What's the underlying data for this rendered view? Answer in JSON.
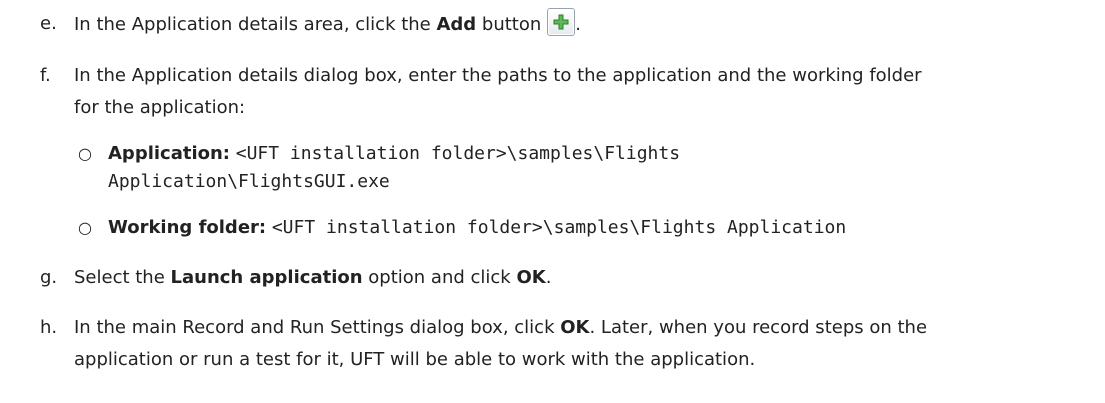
{
  "steps": [
    {
      "marker": "e.",
      "text_a": "In the Application details area, click the ",
      "bold_a": "Add",
      "text_b": " button",
      "text_c": ".",
      "icon": "add-plus-icon"
    },
    {
      "marker": "f.",
      "text_a": "In the Application details dialog box, enter the paths to the application and the working folder",
      "text_b": "for the application:",
      "subitems": [
        {
          "label": "Application:",
          "value_a": "<UFT installation folder>\\samples\\Flights",
          "value_b": "Application\\FlightsGUI.exe"
        },
        {
          "label": "Working folder:",
          "value_a": "<UFT installation folder>\\samples\\Flights Application"
        }
      ]
    },
    {
      "marker": "g.",
      "text_a": "Select the ",
      "bold_a": "Launch application",
      "text_b": " option and click ",
      "bold_b": "OK",
      "text_c": "."
    },
    {
      "marker": "h.",
      "text_a": "In the main Record and Run Settings dialog box, click ",
      "bold_a": "OK",
      "text_b": ". Later, when you record steps on the",
      "text_c": "application or run a test for it, UFT will be able to work with the application."
    }
  ],
  "colors": {
    "text": "#222222",
    "icon_green": "#3c9a2e"
  }
}
